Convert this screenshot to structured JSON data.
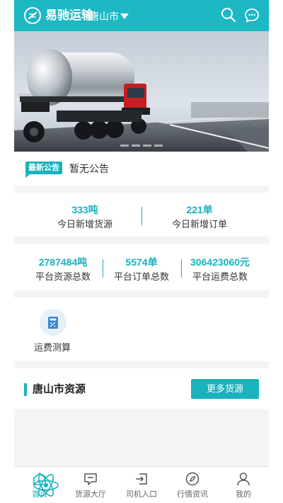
{
  "header": {
    "app_name": "易驰运输",
    "city": "唐山市"
  },
  "notice": {
    "badge": "最新公告",
    "text": "暂无公告"
  },
  "today_stats": [
    {
      "value": "333吨",
      "label": "今日新增货源"
    },
    {
      "value": "221单",
      "label": "今日新增订单"
    }
  ],
  "platform_stats": [
    {
      "value": "2787484吨",
      "label": "平台资源总数"
    },
    {
      "value": "5574单",
      "label": "平台订单总数"
    },
    {
      "value": "306423060元",
      "label": "平台运费总数"
    }
  ],
  "tools": {
    "freight_calc": "运费测算"
  },
  "resources": {
    "title": "唐山市资源",
    "more_button": "更多货源"
  },
  "tabbar": {
    "items": [
      {
        "label": "首页",
        "icon": "home-icon"
      },
      {
        "label": "货源大厅",
        "icon": "cargo-hall-icon"
      },
      {
        "label": "司机入口",
        "icon": "driver-entry-icon"
      },
      {
        "label": "行情资讯",
        "icon": "compass-icon"
      },
      {
        "label": "我的",
        "icon": "profile-icon"
      }
    ]
  },
  "colors": {
    "accent": "#1cb8c4",
    "text": "#333333",
    "background": "#f4f4f4"
  }
}
